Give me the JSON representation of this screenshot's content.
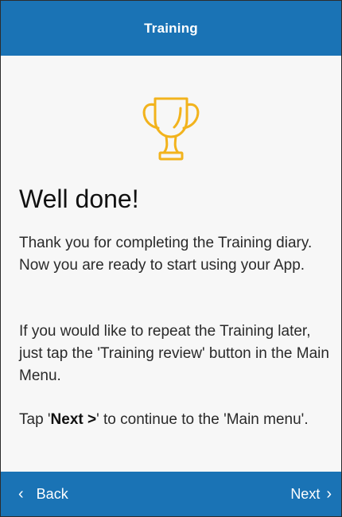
{
  "header": {
    "title": "Training"
  },
  "main": {
    "heading": "Well done!",
    "para1": "Thank you for completing the Training diary. Now you are ready to start using your App.",
    "para2": "If you would like to repeat the Training later, just tap the 'Training review' button in the Main Menu.",
    "para3_pre": "Tap '",
    "para3_strong": "Next >",
    "para3_post": "' to continue to the 'Main menu'."
  },
  "footer": {
    "back_icon": "‹",
    "back_label": "Back",
    "next_label": "Next",
    "next_icon": "›"
  },
  "icons": {
    "trophy": "trophy-icon"
  },
  "colors": {
    "header_bg": "#1a73b5",
    "footer_bg": "#1a73b5",
    "trophy": "#f2b31d",
    "content_bg": "#f7f7f7"
  }
}
